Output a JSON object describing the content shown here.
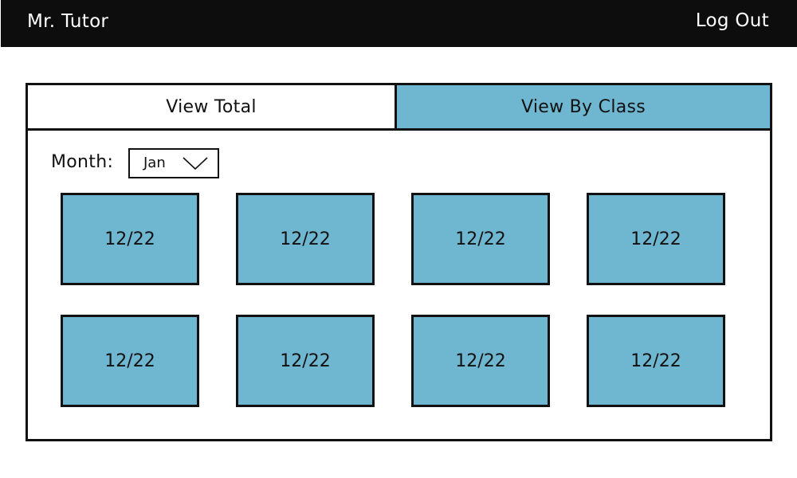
{
  "header": {
    "brand": "Mr. Tutor",
    "logout_label": "Log Out"
  },
  "tabs": [
    {
      "label": "View Total",
      "active": false
    },
    {
      "label": "View By Class",
      "active": true
    }
  ],
  "filter": {
    "month_label": "Month:",
    "month_value": "Jan"
  },
  "cards": [
    {
      "label": "12/22"
    },
    {
      "label": "12/22"
    },
    {
      "label": "12/22"
    },
    {
      "label": "12/22"
    },
    {
      "label": "12/22"
    },
    {
      "label": "12/22"
    },
    {
      "label": "12/22"
    },
    {
      "label": "12/22"
    }
  ],
  "colors": {
    "header_bg": "#0d0d0d",
    "accent": "#6fb6d0"
  },
  "icons": {
    "month_dropdown": "chevron-down-icon"
  }
}
